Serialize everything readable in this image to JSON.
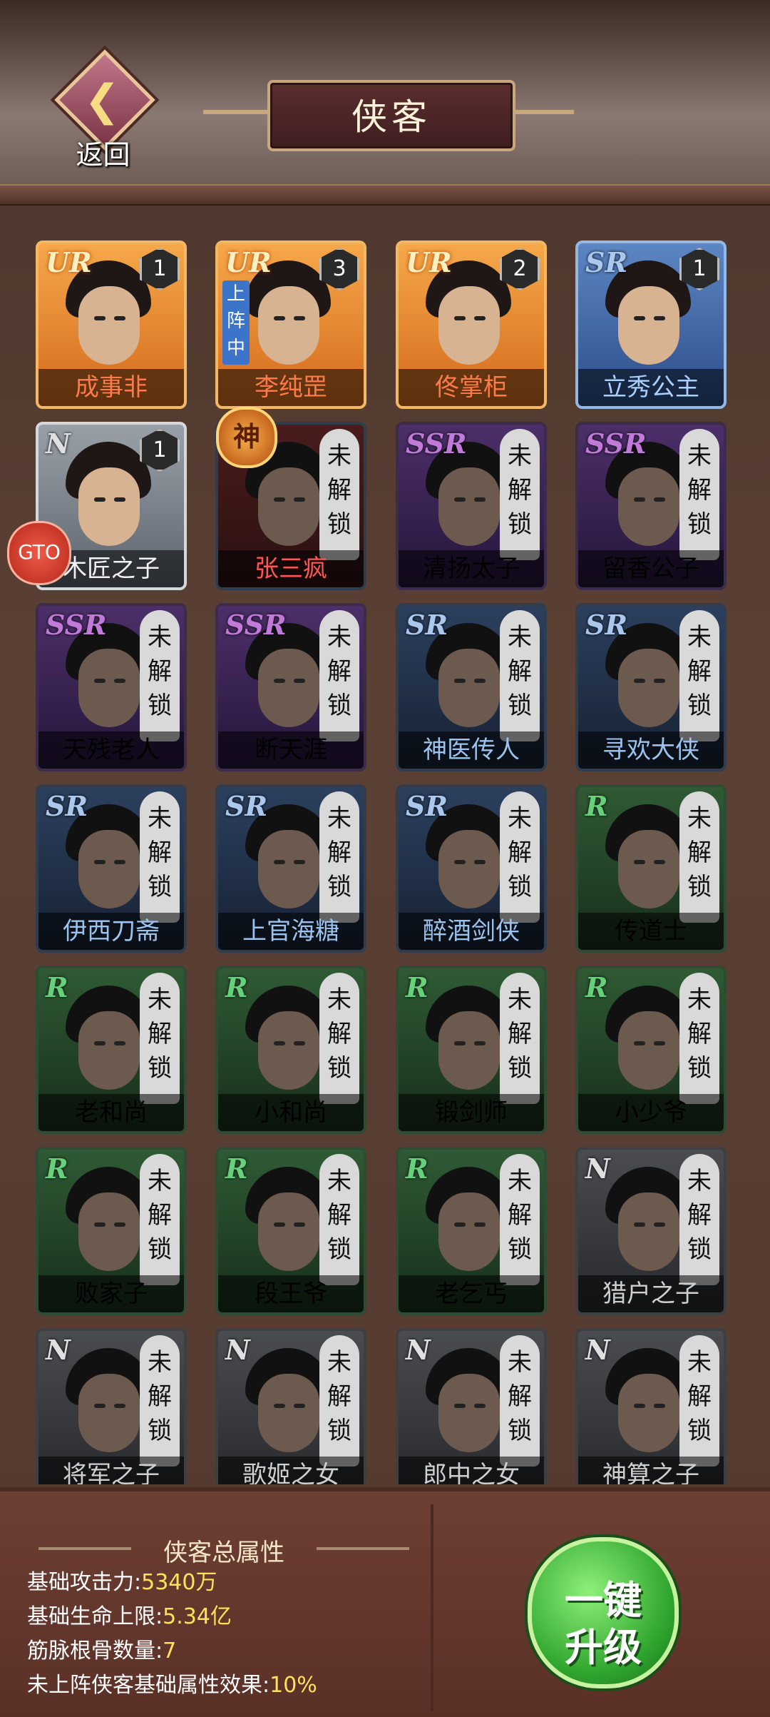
{
  "header": {
    "back_label": "返回",
    "title": "侠客",
    "back_icon": "chevron-left"
  },
  "badges": {
    "god": "神",
    "float_button": "GTO"
  },
  "heroes": [
    {
      "name": "成事非",
      "rarity": "UR",
      "stars": "1",
      "locked": false
    },
    {
      "name": "李纯罡",
      "rarity": "UR",
      "stars": "3",
      "locked": false,
      "deployed": "上阵中"
    },
    {
      "name": "佟掌柜",
      "rarity": "UR",
      "stars": "2",
      "locked": false
    },
    {
      "name": "立秀公主",
      "rarity": "SR",
      "stars": "1",
      "locked": false
    },
    {
      "name": "木匠之子",
      "rarity": "N",
      "stars": "1",
      "locked": false
    },
    {
      "name": "张三疯",
      "rarity": "",
      "stars": "",
      "locked": true
    },
    {
      "name": "清扬太子",
      "rarity": "SSR",
      "stars": "",
      "locked": true
    },
    {
      "name": "留香公子",
      "rarity": "SSR",
      "stars": "",
      "locked": true
    },
    {
      "name": "天残老人",
      "rarity": "SSR",
      "stars": "",
      "locked": true
    },
    {
      "name": "断天涯",
      "rarity": "SSR",
      "stars": "",
      "locked": true
    },
    {
      "name": "神医传人",
      "rarity": "SR",
      "stars": "",
      "locked": true
    },
    {
      "name": "寻欢大侠",
      "rarity": "SR",
      "stars": "",
      "locked": true
    },
    {
      "name": "伊西刀斋",
      "rarity": "SR",
      "stars": "",
      "locked": true
    },
    {
      "name": "上官海糖",
      "rarity": "SR",
      "stars": "",
      "locked": true
    },
    {
      "name": "醉酒剑侠",
      "rarity": "SR",
      "stars": "",
      "locked": true
    },
    {
      "name": "传道士",
      "rarity": "R",
      "stars": "",
      "locked": true
    },
    {
      "name": "老和尚",
      "rarity": "R",
      "stars": "",
      "locked": true
    },
    {
      "name": "小和尚",
      "rarity": "R",
      "stars": "",
      "locked": true
    },
    {
      "name": "锻剑师",
      "rarity": "R",
      "stars": "",
      "locked": true
    },
    {
      "name": "小少爷",
      "rarity": "R",
      "stars": "",
      "locked": true
    },
    {
      "name": "败家子",
      "rarity": "R",
      "stars": "",
      "locked": true
    },
    {
      "name": "段王爷",
      "rarity": "R",
      "stars": "",
      "locked": true
    },
    {
      "name": "老乞丐",
      "rarity": "R",
      "stars": "",
      "locked": true
    },
    {
      "name": "猎户之子",
      "rarity": "N",
      "stars": "",
      "locked": true
    },
    {
      "name": "将军之子",
      "rarity": "N",
      "stars": "",
      "locked": true
    },
    {
      "name": "歌姬之女",
      "rarity": "N",
      "stars": "",
      "locked": true
    },
    {
      "name": "郎中之女",
      "rarity": "N",
      "stars": "",
      "locked": true
    },
    {
      "name": "神算之子",
      "rarity": "N",
      "stars": "",
      "locked": true
    }
  ],
  "lock_label": "未解锁",
  "stats": {
    "title": "侠客总属性",
    "attack_label": "基础攻击力:",
    "attack_value": "5340万",
    "hp_label": "基础生命上限:",
    "hp_value": "5.34亿",
    "tendon_label": "筋脉根骨数量:",
    "tendon_value": "7",
    "effect_label": "未上阵侠客基础属性效果:",
    "effect_value": "10%"
  },
  "upgrade_button": {
    "line1": "一键",
    "line2": "升级"
  }
}
